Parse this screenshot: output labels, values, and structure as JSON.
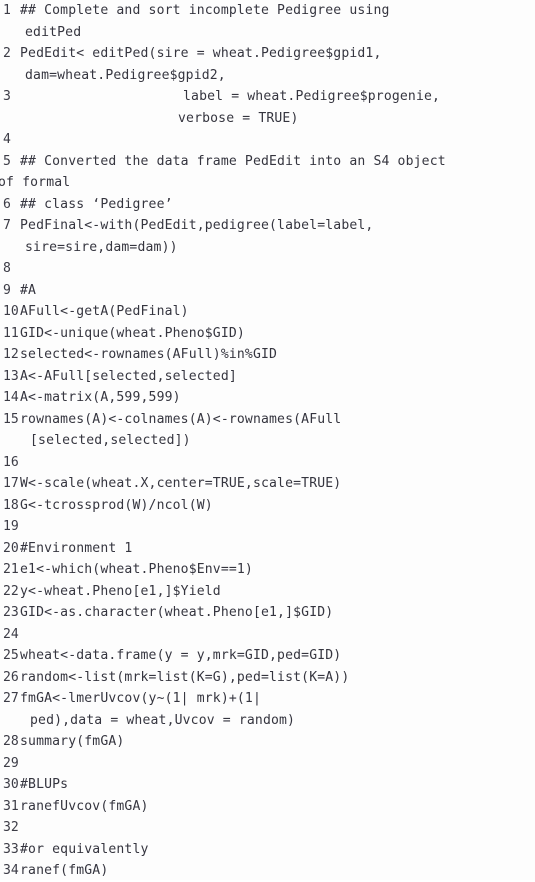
{
  "listing": {
    "language": "R",
    "colors": {
      "background": "#fdfdfd",
      "text": "#35353f",
      "line_number": "#3c3c46"
    },
    "lines": [
      {
        "number": "1",
        "segments": [
          {
            "text": "## Complete and sort incomplete Pedigree using",
            "indent": "none"
          },
          {
            "text": "editPed",
            "indent": "small"
          }
        ]
      },
      {
        "number": "2",
        "segments": [
          {
            "text": "PedEdit< editPed(sire = wheat.Pedigree$gpid1,",
            "indent": "none"
          },
          {
            "text": "dam=wheat.Pedigree$gpid2,",
            "indent": "small"
          }
        ]
      },
      {
        "number": "3",
        "segments": [
          {
            "text": "label = wheat.Pedigree$progenie,",
            "indent": "first-deep"
          },
          {
            "text": "verbose = TRUE)",
            "indent": "deep"
          }
        ]
      },
      {
        "number": "4",
        "segments": [
          {
            "text": "",
            "indent": "none"
          }
        ]
      },
      {
        "number": "5",
        "segments": [
          {
            "text": "## Converted the data frame PedEdit into an S4 object",
            "indent": "none"
          },
          {
            "text": "of formal",
            "indent": "zero"
          }
        ]
      },
      {
        "number": "6",
        "segments": [
          {
            "text": "## class ‘Pedigree’",
            "indent": "none"
          }
        ]
      },
      {
        "number": "7",
        "segments": [
          {
            "text": "PedFinal<-with(PedEdit,pedigree(label=label,",
            "indent": "none"
          },
          {
            "text": "sire=sire,dam=dam))",
            "indent": "small"
          }
        ]
      },
      {
        "number": "8",
        "segments": [
          {
            "text": "",
            "indent": "none"
          }
        ]
      },
      {
        "number": "9",
        "segments": [
          {
            "text": "#A",
            "indent": "none"
          }
        ]
      },
      {
        "number": "10",
        "segments": [
          {
            "text": "AFull<-getA(PedFinal)",
            "indent": "none"
          }
        ]
      },
      {
        "number": "11",
        "segments": [
          {
            "text": "GID<-unique(wheat.Pheno$GID)",
            "indent": "none"
          }
        ]
      },
      {
        "number": "12",
        "segments": [
          {
            "text": "selected<-rownames(AFull)%in%GID",
            "indent": "none"
          }
        ]
      },
      {
        "number": "13",
        "segments": [
          {
            "text": "A<-AFull[selected,selected]",
            "indent": "none"
          }
        ]
      },
      {
        "number": "14",
        "segments": [
          {
            "text": "A<-matrix(A,599,599)",
            "indent": "none"
          }
        ]
      },
      {
        "number": "15",
        "segments": [
          {
            "text": "rownames(A)<-colnames(A)<-rownames(AFull",
            "indent": "none"
          },
          {
            "text": "[selected,selected])",
            "indent": "medium"
          }
        ]
      },
      {
        "number": "16",
        "segments": [
          {
            "text": "",
            "indent": "none"
          }
        ]
      },
      {
        "number": "17",
        "segments": [
          {
            "text": "W<-scale(wheat.X,center=TRUE,scale=TRUE)",
            "indent": "none"
          }
        ]
      },
      {
        "number": "18",
        "segments": [
          {
            "text": "G<-tcrossprod(W)/ncol(W)",
            "indent": "none"
          }
        ]
      },
      {
        "number": "19",
        "segments": [
          {
            "text": "",
            "indent": "none"
          }
        ]
      },
      {
        "number": "20",
        "segments": [
          {
            "text": "#Environment 1",
            "indent": "none"
          }
        ]
      },
      {
        "number": "21",
        "segments": [
          {
            "text": "e1<-which(wheat.Pheno$Env==1)",
            "indent": "none"
          }
        ]
      },
      {
        "number": "22",
        "segments": [
          {
            "text": "y<-wheat.Pheno[e1,]$Yield",
            "indent": "none"
          }
        ]
      },
      {
        "number": "23",
        "segments": [
          {
            "text": "GID<-as.character(wheat.Pheno[e1,]$GID)",
            "indent": "none"
          }
        ]
      },
      {
        "number": "24",
        "segments": [
          {
            "text": "",
            "indent": "none"
          }
        ]
      },
      {
        "number": "25",
        "segments": [
          {
            "text": "wheat<-data.frame(y = y,mrk=GID,ped=GID)",
            "indent": "none"
          }
        ]
      },
      {
        "number": "26",
        "segments": [
          {
            "text": "random<-list(mrk=list(K=G),ped=list(K=A))",
            "indent": "none"
          }
        ]
      },
      {
        "number": "27",
        "segments": [
          {
            "text": "fmGA<-lmerUvcov(y~(1| mrk)+(1|",
            "indent": "none"
          },
          {
            "text": "ped),data = wheat,Uvcov = random)",
            "indent": "medium"
          }
        ]
      },
      {
        "number": "28",
        "segments": [
          {
            "text": "summary(fmGA)",
            "indent": "none"
          }
        ]
      },
      {
        "number": "29",
        "segments": [
          {
            "text": "",
            "indent": "none"
          }
        ]
      },
      {
        "number": "30",
        "segments": [
          {
            "text": "#BLUPs",
            "indent": "none"
          }
        ]
      },
      {
        "number": "31",
        "segments": [
          {
            "text": "ranefUvcov(fmGA)",
            "indent": "none"
          }
        ]
      },
      {
        "number": "32",
        "segments": [
          {
            "text": "",
            "indent": "none"
          }
        ]
      },
      {
        "number": "33",
        "segments": [
          {
            "text": "#or equivalently",
            "indent": "none"
          }
        ]
      },
      {
        "number": "34",
        "segments": [
          {
            "text": "ranef(fmGA)",
            "indent": "none"
          }
        ]
      }
    ]
  }
}
